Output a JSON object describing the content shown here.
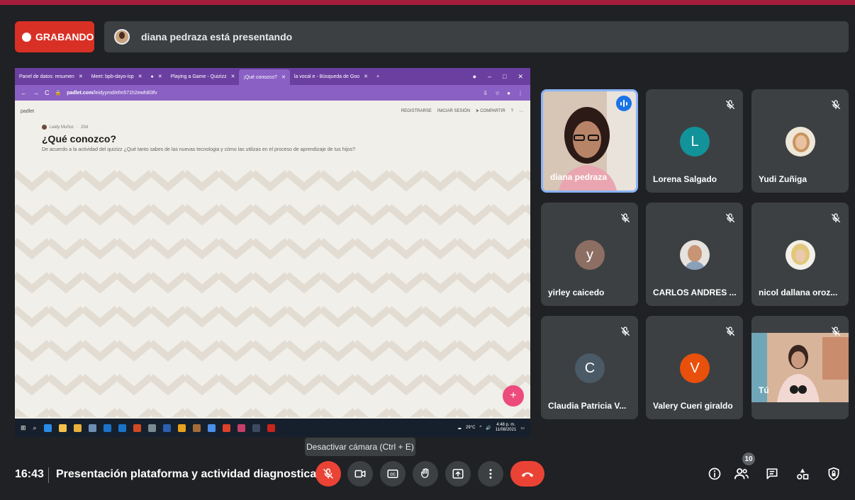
{
  "recording": {
    "label": "GRABANDO"
  },
  "presenting": {
    "text": "diana pedraza está presentando"
  },
  "shared_screen": {
    "tabs": [
      {
        "label": "Panel de datos: resumen"
      },
      {
        "label": "Meet: bpb-dayo-isp"
      },
      {
        "label": ""
      },
      {
        "label": "Playing a Game - Quizizz"
      },
      {
        "label": "¡Qué conozco?"
      },
      {
        "label": "la vocal e - Búsqueda de Goo"
      }
    ],
    "url_domain": "padlet.com",
    "url_path": "/leidyymd/efm571h2ewh8l3fv",
    "brand": "padlet",
    "actions": [
      "REGISTRARSE",
      "INICIAR SESIÓN",
      "COMPARTIR"
    ],
    "author": "Leidy Muñoz",
    "author_time": "20d",
    "title": "¿Qué conozco?",
    "description": "De acuerdo a la actividad del quizizz ¿Qué tanto sabes de las nuevas tecnologia y cómo las utilizas en el proceso de aprendizaje de tus hijos?",
    "fab": "+",
    "tray_temp": "29°C",
    "tray_time": "4:48 p. m.",
    "tray_date": "11/08/2021"
  },
  "tooltip": {
    "text": "Desactivar cámara (Ctrl + E)"
  },
  "participants": [
    {
      "name": "diana pedraza",
      "type": "video"
    },
    {
      "name": "Lorena Salgado",
      "type": "letter",
      "letter": "L",
      "color": "#12939a"
    },
    {
      "name": "Yudi Zuñiga",
      "type": "photo"
    },
    {
      "name": "yirley caicedo",
      "type": "letter",
      "letter": "y",
      "color": "#8d6e63"
    },
    {
      "name": "CARLOS ANDRES ...",
      "type": "photo"
    },
    {
      "name": "nicol dallana oroz...",
      "type": "photo"
    },
    {
      "name": "Claudia Patricia V...",
      "type": "letter",
      "letter": "C",
      "color": "#4a5a66"
    },
    {
      "name": "Valery Cueri giraldo",
      "type": "letter",
      "letter": "V",
      "color": "#e8500c"
    },
    {
      "name": "Tú",
      "type": "video"
    }
  ],
  "meeting": {
    "time": "16:43",
    "title": "Presentación plataforma y actividad diagnostica"
  },
  "people_count": "10",
  "colors": {
    "accent_red": "#ea4335",
    "recording_red": "#d93025",
    "bar_gray": "#3c4043",
    "padlet_purple": "#6b3fa0"
  }
}
